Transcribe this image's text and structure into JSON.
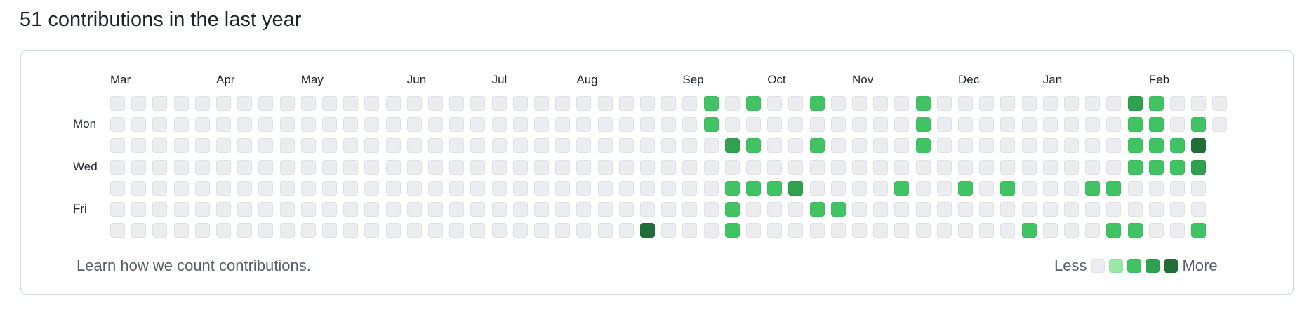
{
  "header": {
    "title": "51 contributions in the last year"
  },
  "graph": {
    "months": [
      {
        "label": "Mar",
        "week": 0
      },
      {
        "label": "Apr",
        "week": 5
      },
      {
        "label": "May",
        "week": 9
      },
      {
        "label": "Jun",
        "week": 14
      },
      {
        "label": "Jul",
        "week": 18
      },
      {
        "label": "Aug",
        "week": 22
      },
      {
        "label": "Sep",
        "week": 27
      },
      {
        "label": "Oct",
        "week": 31
      },
      {
        "label": "Nov",
        "week": 35
      },
      {
        "label": "Dec",
        "week": 40
      },
      {
        "label": "Jan",
        "week": 44
      },
      {
        "label": "Feb",
        "week": 49
      }
    ],
    "day_labels": [
      {
        "label": "Mon",
        "row": 1
      },
      {
        "label": "Wed",
        "row": 3
      },
      {
        "label": "Fri",
        "row": 5
      }
    ],
    "weeks": 53,
    "last_week_days": 2,
    "levels_by_row": [
      "00000000000000000000000000002020020000200000000032000",
      "00000000000000000000000000002000000000200000000022020",
      "0000000000000000000000000000032002000020000000002224",
      "0000000000000000000000000000000000000000000000002223",
      "0000000000000000000000000000022230000200202000220000",
      "0000000000000000000000000000020002200000000000000000",
      "0000000000000000000000000400020000000000000200022002"
    ],
    "level_colors": [
      "#ebedf0",
      "#9be9a8",
      "#40c463",
      "#30a14e",
      "#216e39"
    ]
  },
  "footer": {
    "learn_link": "Learn how we count contributions."
  },
  "legend": {
    "less": "Less",
    "more": "More"
  }
}
